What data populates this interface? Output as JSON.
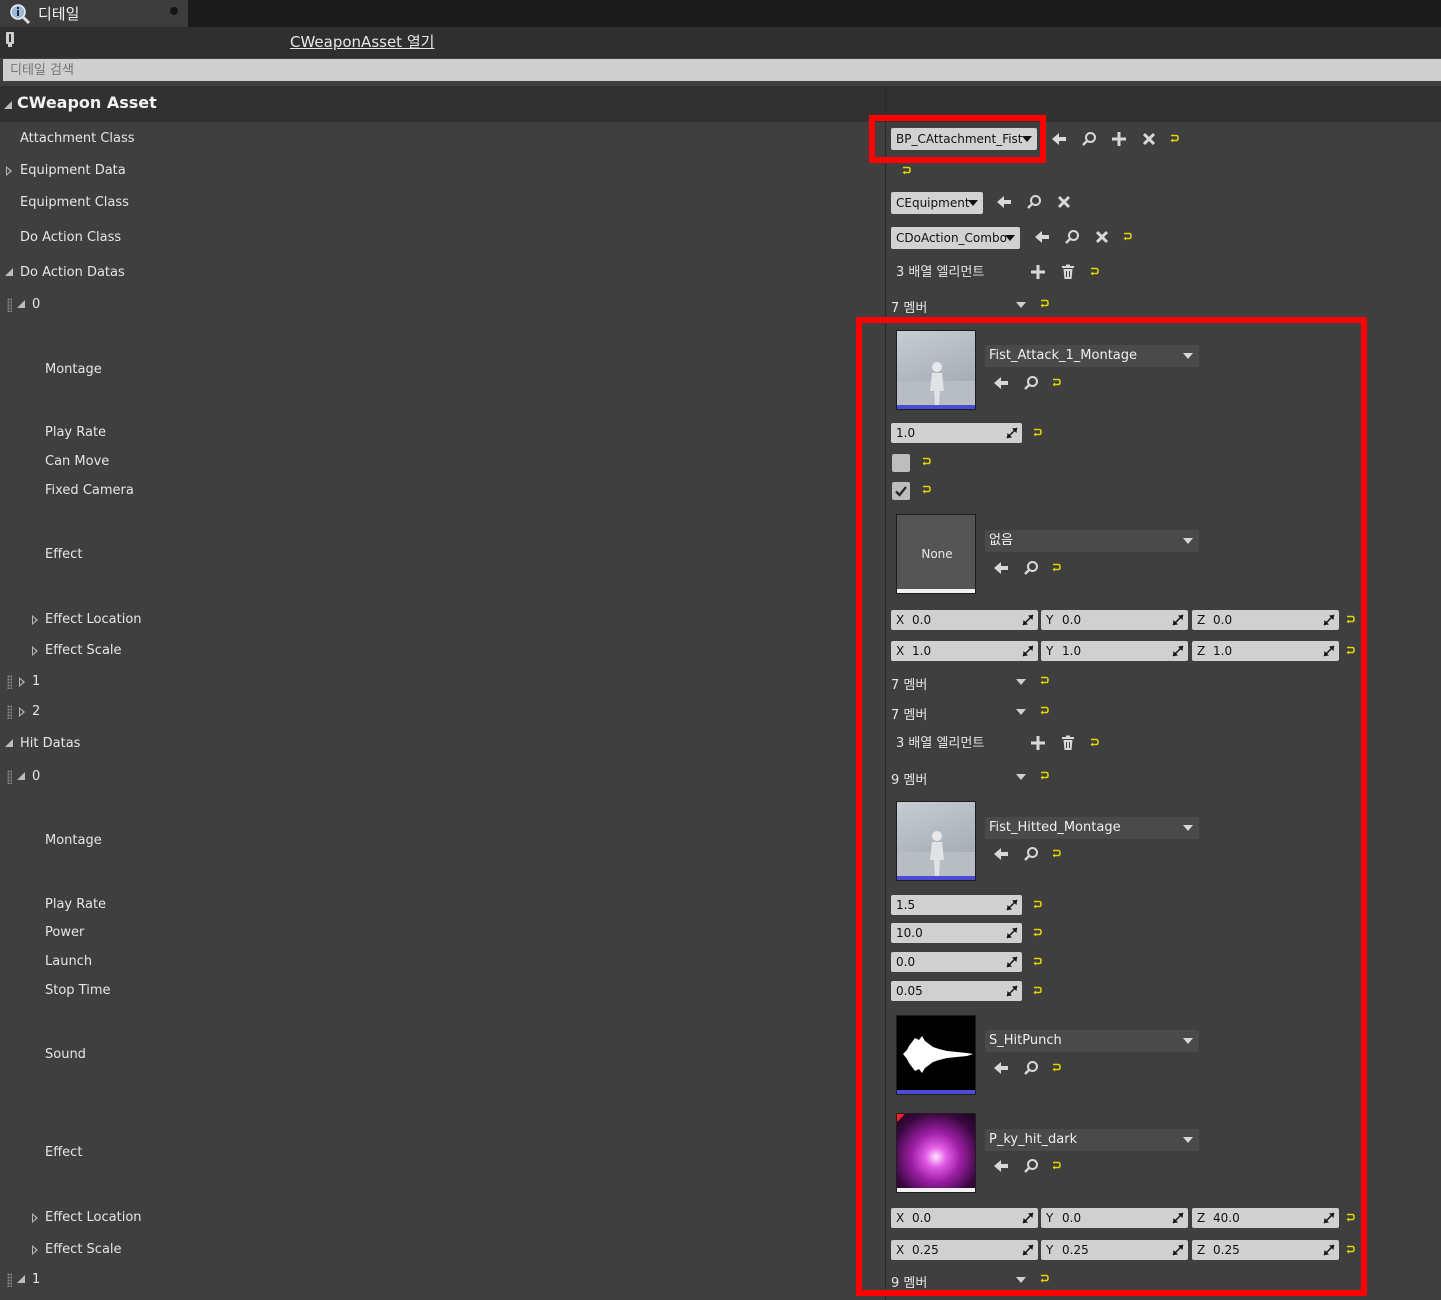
{
  "tab": {
    "title": "디테일"
  },
  "toolbar": {
    "open_asset": "CWeaponAsset 열기"
  },
  "search": {
    "placeholder": "디테일 검색"
  },
  "category": {
    "title": "CWeapon Asset"
  },
  "props": {
    "attachment_class": {
      "label": "Attachment Class",
      "value": "BP_CAttachment_Fist"
    },
    "equipment_data": {
      "label": "Equipment Data"
    },
    "equipment_class": {
      "label": "Equipment Class",
      "value": "CEquipment"
    },
    "do_action_class": {
      "label": "Do Action Class",
      "value": "CDoAction_Combo"
    },
    "do_action_datas": {
      "label": "Do Action Datas",
      "count": "3 배열 엘리먼트",
      "items": [
        {
          "index": "0",
          "members": "7 멤버",
          "montage": {
            "label": "Montage",
            "value": "Fist_Attack_1_Montage"
          },
          "play_rate": {
            "label": "Play Rate",
            "value": "1.0"
          },
          "can_move": {
            "label": "Can Move",
            "checked": false
          },
          "fixed_camera": {
            "label": "Fixed Camera",
            "checked": true
          },
          "effect": {
            "label": "Effect",
            "value": "없음",
            "thumb_text": "None"
          },
          "effect_location": {
            "label": "Effect Location",
            "x": "0.0",
            "y": "0.0",
            "z": "0.0"
          },
          "effect_scale": {
            "label": "Effect Scale",
            "x": "1.0",
            "y": "1.0",
            "z": "1.0"
          }
        },
        {
          "index": "1",
          "members": "7 멤버"
        },
        {
          "index": "2",
          "members": "7 멤버"
        }
      ]
    },
    "hit_datas": {
      "label": "Hit Datas",
      "count": "3 배열 엘리먼트",
      "items": [
        {
          "index": "0",
          "members": "9 멤버",
          "montage": {
            "label": "Montage",
            "value": "Fist_Hitted_Montage"
          },
          "play_rate": {
            "label": "Play Rate",
            "value": "1.5"
          },
          "power": {
            "label": "Power",
            "value": "10.0"
          },
          "launch": {
            "label": "Launch",
            "value": "0.0"
          },
          "stop_time": {
            "label": "Stop Time",
            "value": "0.05"
          },
          "sound": {
            "label": "Sound",
            "value": "S_HitPunch"
          },
          "effect": {
            "label": "Effect",
            "value": "P_ky_hit_dark"
          },
          "effect_location": {
            "label": "Effect Location",
            "x": "0.0",
            "y": "0.0",
            "z": "40.0"
          },
          "effect_scale": {
            "label": "Effect Scale",
            "x": "0.25",
            "y": "0.25",
            "z": "0.25"
          }
        },
        {
          "index": "1",
          "members": "9 멤버"
        }
      ]
    }
  },
  "axis_labels": {
    "x": "X",
    "y": "Y",
    "z": "Z"
  },
  "colors": {
    "highlight": "#ff0000",
    "reset_arrow": "#e3d400",
    "panel_bg": "#3f3f3f"
  },
  "icons": [
    "details-icon",
    "lock-icon",
    "use-selected-icon",
    "browse-icon",
    "add-icon",
    "clear-icon",
    "reset-icon",
    "delete-icon",
    "spin-icon"
  ]
}
